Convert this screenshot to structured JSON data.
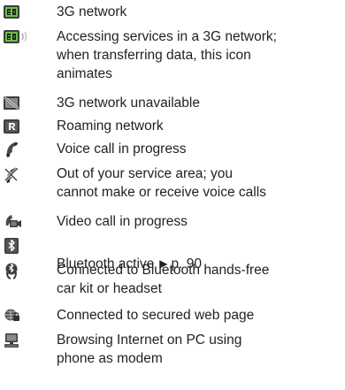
{
  "items": [
    {
      "icon": "3g-network-icon",
      "text": "3G network"
    },
    {
      "icon": "3g-network-accessing-icon",
      "text": "Accessing services in a 3G network;\nwhen transferring data, this icon\nanimates"
    },
    {
      "icon": "3g-unavailable-icon",
      "text": "3G network unavailable"
    },
    {
      "icon": "roaming-icon",
      "text": "Roaming network"
    },
    {
      "icon": "voice-call-icon",
      "text": "Voice call in progress"
    },
    {
      "icon": "no-service-icon",
      "text": "Out of your service area; you\ncannot make or receive voice calls"
    },
    {
      "icon": "video-call-icon",
      "text": "Video call in progress"
    },
    {
      "icon": "bluetooth-icon",
      "text": "Bluetooth active",
      "xref": "p. 90"
    },
    {
      "icon": "bluetooth-headset-icon",
      "text": "Connected to Bluetooth hands-free\ncar kit or headset"
    },
    {
      "icon": "secured-web-icon",
      "text": "Connected to secured web page"
    },
    {
      "icon": "pc-modem-icon",
      "text": "Browsing Internet on PC using\nphone as modem"
    }
  ],
  "colors": {
    "text": "#231f20",
    "icon_dark": "#3d3d3d",
    "icon_green": "#4e8f3a"
  }
}
